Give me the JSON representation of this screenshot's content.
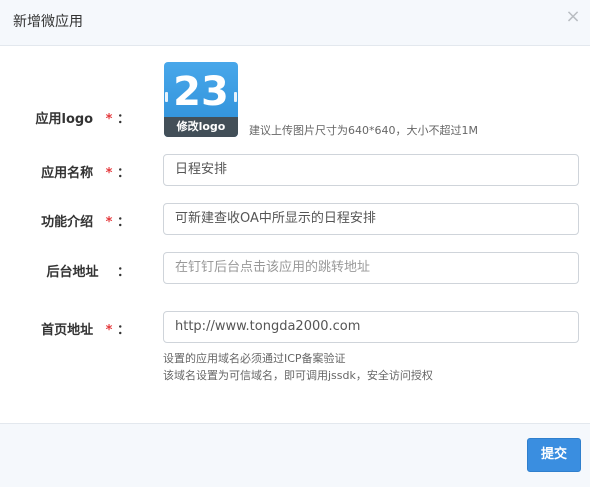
{
  "dialog": {
    "title": "新增微应用",
    "close_glyph": "×"
  },
  "form": {
    "logo": {
      "label": "应用logo",
      "required_mark": "*",
      "colon": "：",
      "icon_text": "23",
      "change_label": "修改logo",
      "hint": "建议上传图片尺寸为640*640，大小不超过1M"
    },
    "name": {
      "label": "应用名称",
      "required_mark": "*",
      "colon": "：",
      "value": "日程安排"
    },
    "intro": {
      "label": "功能介绍",
      "required_mark": "*",
      "colon": "：",
      "value": "可新建查收OA中所显示的日程安排"
    },
    "backend": {
      "label": "后台地址",
      "colon": "：",
      "placeholder": "在钉钉后台点击该应用的跳转地址"
    },
    "homepage": {
      "label": "首页地址",
      "required_mark": "*",
      "colon": "：",
      "value": "http://www.tongda2000.com",
      "hint_line1": "设置的应用域名必须通过ICP备案验证",
      "hint_line2": "该域名设置为可信域名，即可调用jssdk，安全访问授权"
    }
  },
  "footer": {
    "submit_label": "提交"
  },
  "colors": {
    "accent": "#3a8ee0",
    "required": "#e4393c",
    "header_bg": "#f5f8fc"
  },
  "icons": {
    "close": "close-icon",
    "app_logo": "calendar-app-icon"
  }
}
